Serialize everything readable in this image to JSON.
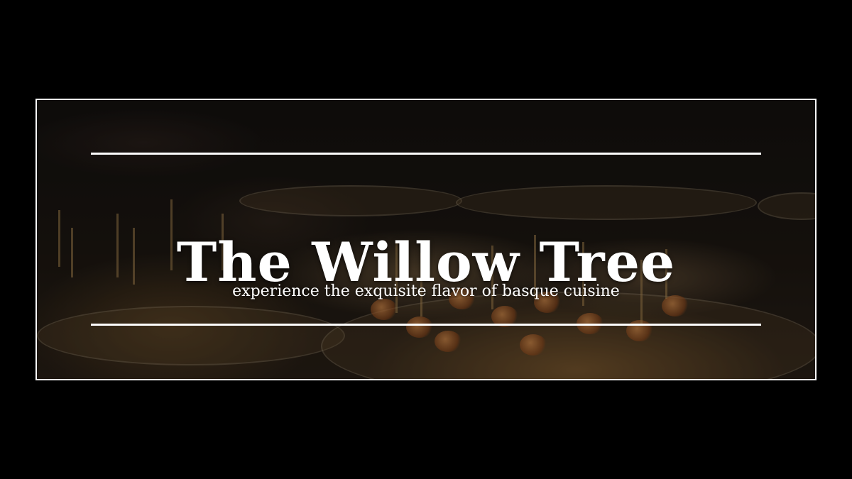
{
  "hero": {
    "title": "The Willow Tree",
    "tagline": "experience the exquisite flavor of basque cuisine"
  },
  "colors": {
    "page_background": "#000000",
    "frame_border": "#ffffff",
    "text": "#ffffff"
  }
}
